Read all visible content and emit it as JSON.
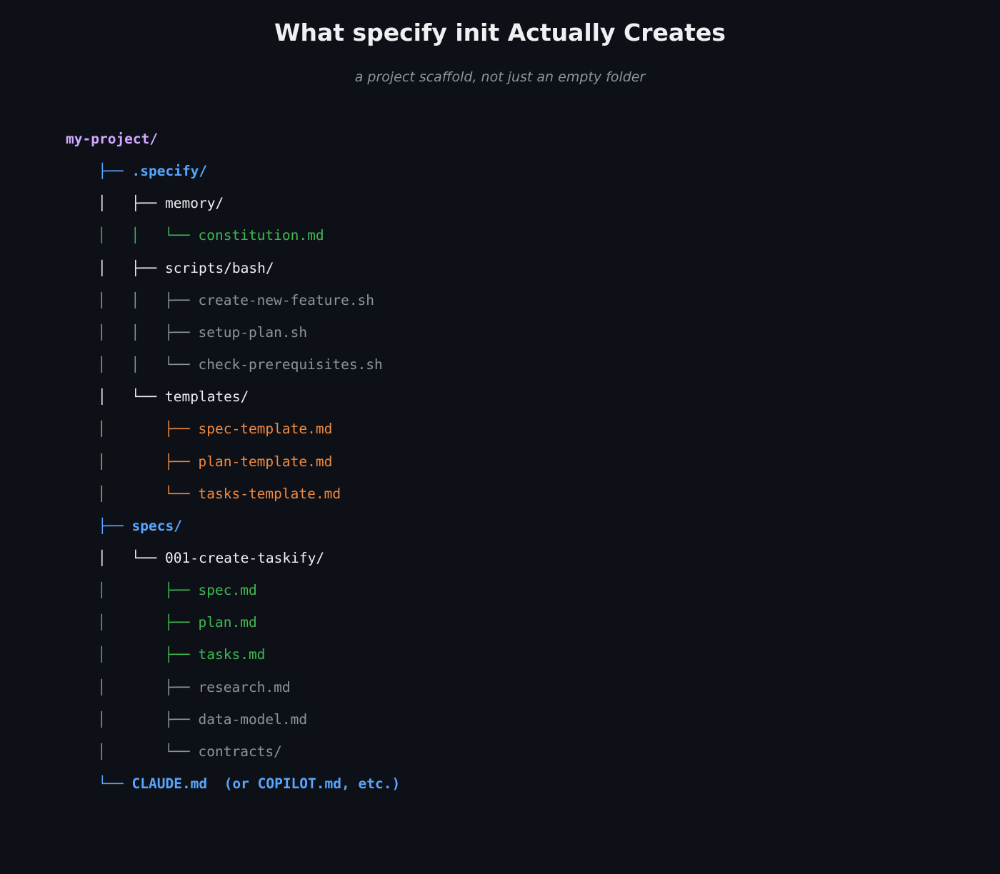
{
  "title": "What specify init Actually Creates",
  "subtitle": "a project scaffold, not just an empty folder",
  "colors": {
    "background": "#0d1117",
    "root": "#d2a8ff",
    "top_dir": "#58a6ff",
    "sub_dir": "#eef0f2",
    "core_file": "#3fb950",
    "script_file": "#8b949e",
    "template_file": "#f0883e"
  },
  "tree": [
    {
      "depth": 0,
      "prefix": "",
      "name": "my-project/",
      "color": "#d2a8ff",
      "bold": true,
      "prefix_color": "#d2a8ff"
    },
    {
      "depth": 1,
      "prefix": "├──",
      "name": ".specify/",
      "color": "#58a6ff",
      "bold": true,
      "prefix_color": "#58a6ff"
    },
    {
      "depth": 2,
      "prefix": "│   ├──",
      "name": "memory/",
      "color": "#eef0f2",
      "bold": false,
      "prefix_color": "#eef0f2"
    },
    {
      "depth": 3,
      "prefix": "│   │   └──",
      "name": "constitution.md",
      "color": "#3fb950",
      "bold": false,
      "prefix_color": "#3fb950"
    },
    {
      "depth": 2,
      "prefix": "│   ├──",
      "name": "scripts/bash/",
      "color": "#eef0f2",
      "bold": false,
      "prefix_color": "#eef0f2"
    },
    {
      "depth": 3,
      "prefix": "│   │   ├──",
      "name": "create-new-feature.sh",
      "color": "#8b949e",
      "bold": false,
      "prefix_color": "#8b949e"
    },
    {
      "depth": 3,
      "prefix": "│   │   ├──",
      "name": "setup-plan.sh",
      "color": "#8b949e",
      "bold": false,
      "prefix_color": "#8b949e"
    },
    {
      "depth": 3,
      "prefix": "│   │   └──",
      "name": "check-prerequisites.sh",
      "color": "#8b949e",
      "bold": false,
      "prefix_color": "#8b949e"
    },
    {
      "depth": 2,
      "prefix": "│   └──",
      "name": "templates/",
      "color": "#eef0f2",
      "bold": false,
      "prefix_color": "#eef0f2"
    },
    {
      "depth": 3,
      "prefix": "│       ├──",
      "name": "spec-template.md",
      "color": "#f0883e",
      "bold": false,
      "prefix_color": "#f0883e"
    },
    {
      "depth": 3,
      "prefix": "│       ├──",
      "name": "plan-template.md",
      "color": "#f0883e",
      "bold": false,
      "prefix_color": "#f0883e"
    },
    {
      "depth": 3,
      "prefix": "│       └──",
      "name": "tasks-template.md",
      "color": "#f0883e",
      "bold": false,
      "prefix_color": "#f0883e"
    },
    {
      "depth": 1,
      "prefix": "├──",
      "name": "specs/",
      "color": "#58a6ff",
      "bold": true,
      "prefix_color": "#58a6ff"
    },
    {
      "depth": 2,
      "prefix": "│   └──",
      "name": "001-create-taskify/",
      "color": "#eef0f2",
      "bold": false,
      "prefix_color": "#eef0f2"
    },
    {
      "depth": 3,
      "prefix": "│       ├──",
      "name": "spec.md",
      "color": "#3fb950",
      "bold": false,
      "prefix_color": "#3fb950"
    },
    {
      "depth": 3,
      "prefix": "│       ├──",
      "name": "plan.md",
      "color": "#3fb950",
      "bold": false,
      "prefix_color": "#3fb950"
    },
    {
      "depth": 3,
      "prefix": "│       ├──",
      "name": "tasks.md",
      "color": "#3fb950",
      "bold": false,
      "prefix_color": "#3fb950"
    },
    {
      "depth": 3,
      "prefix": "│       ├──",
      "name": "research.md",
      "color": "#8b949e",
      "bold": false,
      "prefix_color": "#8b949e"
    },
    {
      "depth": 3,
      "prefix": "│       ├──",
      "name": "data-model.md",
      "color": "#8b949e",
      "bold": false,
      "prefix_color": "#8b949e"
    },
    {
      "depth": 3,
      "prefix": "│       └──",
      "name": "contracts/",
      "color": "#8b949e",
      "bold": false,
      "prefix_color": "#8b949e"
    },
    {
      "depth": 1,
      "prefix": "└──",
      "name": "CLAUDE.md  (or COPILOT.md, etc.)",
      "color": "#58a6ff",
      "bold": true,
      "prefix_color": "#58a6ff"
    }
  ]
}
